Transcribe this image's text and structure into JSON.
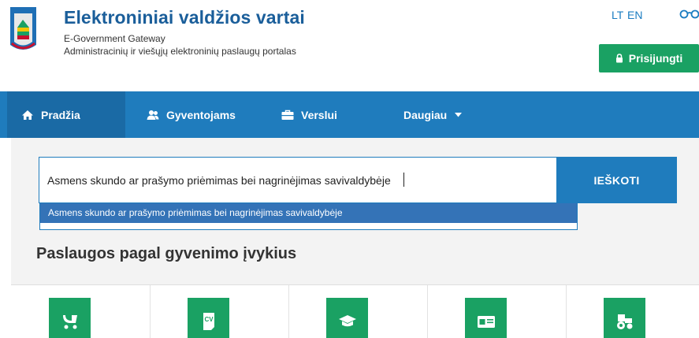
{
  "header": {
    "title": "Elektroniniai valdžios vartai",
    "subtitle": "E-Government Gateway",
    "description": "Administracinių ir viešųjų elektroninių paslaugų portalas",
    "lang_lt": "LT",
    "lang_en": "EN",
    "login_label": "Prisijungti",
    "accessibility_icon": "glasses-icon"
  },
  "nav": {
    "items": [
      {
        "label": "Pradžia",
        "icon": "home-icon",
        "active": true
      },
      {
        "label": "Gyventojams",
        "icon": "users-icon"
      },
      {
        "label": "Verslui",
        "icon": "briefcase-icon"
      },
      {
        "label": "Daugiau",
        "icon": "caret-down-icon"
      }
    ]
  },
  "search": {
    "value": "Asmens skundo ar prašymo priėmimas bei nagrinėjimas savivaldybėje",
    "button_label": "IEŠKOTI",
    "suggestions": [
      "Asmens skundo ar prašymo priėmimas bei nagrinėjimas savivaldybėje"
    ]
  },
  "life_events": {
    "title": "Paslaugos pagal gyvenimo įvykius",
    "cards": [
      {
        "icon": "stroller-icon"
      },
      {
        "icon": "cv-icon"
      },
      {
        "icon": "graduation-cap-icon"
      },
      {
        "icon": "id-card-icon"
      },
      {
        "icon": "tractor-icon"
      }
    ]
  },
  "colors": {
    "brand_blue": "#1f7cbd",
    "green": "#1aa163",
    "title_blue": "#1a5e9a"
  }
}
